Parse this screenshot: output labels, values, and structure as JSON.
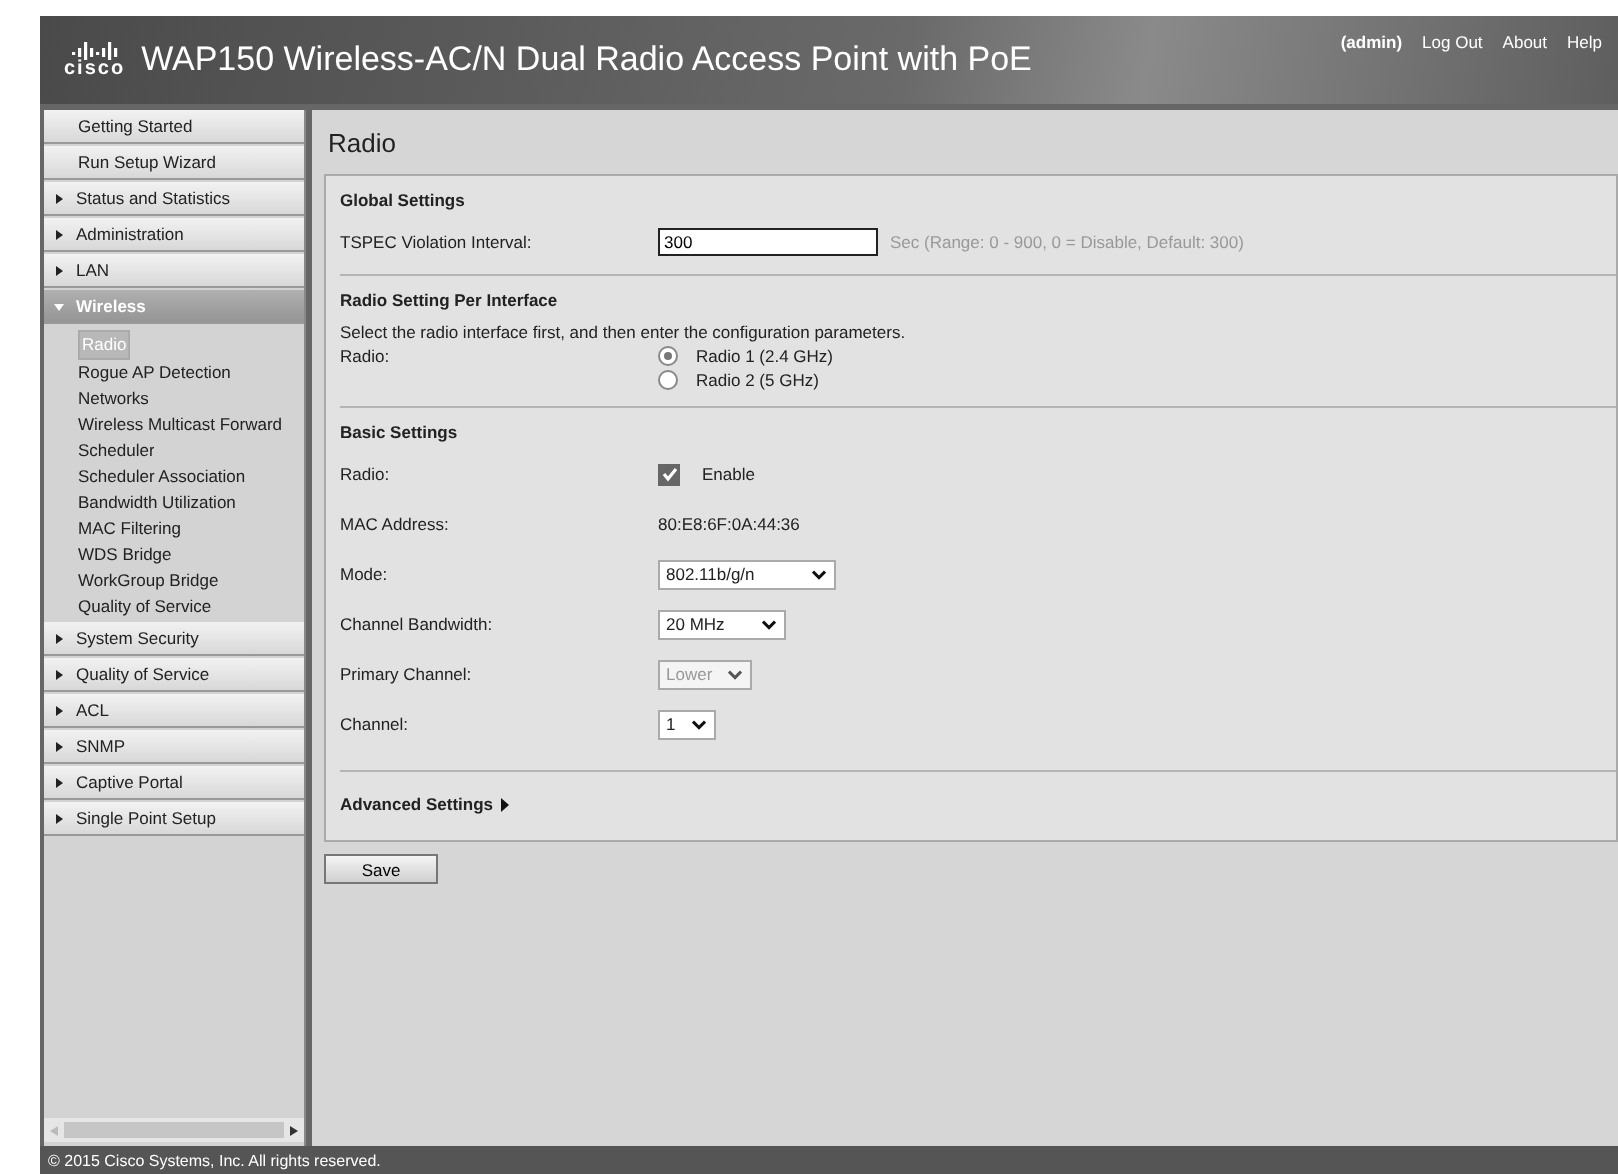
{
  "header": {
    "logo": "cisco",
    "title": "WAP150 Wireless-AC/N Dual Radio Access Point with PoE",
    "user": "(admin)",
    "links": [
      "Log Out",
      "About",
      "Help"
    ]
  },
  "sidebar": {
    "items": [
      {
        "kind": "link",
        "label": "Getting Started"
      },
      {
        "kind": "link",
        "label": "Run Setup Wizard"
      },
      {
        "kind": "group",
        "label": "Status and Statistics",
        "expanded": false
      },
      {
        "kind": "group",
        "label": "Administration",
        "expanded": false
      },
      {
        "kind": "group",
        "label": "LAN",
        "expanded": false
      },
      {
        "kind": "group",
        "label": "Wireless",
        "expanded": true,
        "children": [
          {
            "label": "Radio",
            "selected": true
          },
          {
            "label": "Rogue AP Detection",
            "selected": false
          },
          {
            "label": "Networks",
            "selected": false
          },
          {
            "label": "Wireless Multicast Forward",
            "selected": false
          },
          {
            "label": "Scheduler",
            "selected": false
          },
          {
            "label": "Scheduler Association",
            "selected": false
          },
          {
            "label": "Bandwidth Utilization",
            "selected": false
          },
          {
            "label": "MAC Filtering",
            "selected": false
          },
          {
            "label": "WDS Bridge",
            "selected": false
          },
          {
            "label": "WorkGroup Bridge",
            "selected": false
          },
          {
            "label": "Quality of Service",
            "selected": false
          }
        ]
      },
      {
        "kind": "group",
        "label": "System Security",
        "expanded": false
      },
      {
        "kind": "group",
        "label": "Quality of Service",
        "expanded": false
      },
      {
        "kind": "group",
        "label": "ACL",
        "expanded": false
      },
      {
        "kind": "group",
        "label": "SNMP",
        "expanded": false
      },
      {
        "kind": "group",
        "label": "Captive Portal",
        "expanded": false
      },
      {
        "kind": "group",
        "label": "Single Point Setup",
        "expanded": false
      }
    ]
  },
  "page_title": "Radio",
  "sections": [
    {
      "title": "Global Settings",
      "rows": [
        {
          "kind": "text",
          "label": "TSPEC Violation Interval:",
          "value": "300",
          "hint": "Sec (Range: 0 - 900, 0 = Disable, Default: 300)"
        }
      ]
    },
    {
      "title": "Radio Setting Per Interface",
      "note": "Select the radio interface first, and then enter the configuration parameters.",
      "rows": [
        {
          "kind": "radio",
          "label": "Radio:",
          "options": [
            {
              "label": "Radio 1 (2.4 GHz)",
              "selected": true
            },
            {
              "label": "Radio 2 (5 GHz)",
              "selected": false
            }
          ]
        }
      ]
    },
    {
      "title": "Basic Settings",
      "rows": [
        {
          "kind": "checkbox",
          "label": "Radio:",
          "checked": true,
          "text": "Enable"
        },
        {
          "kind": "static",
          "label": "MAC Address:",
          "value": "80:E8:6F:0A:44:36"
        },
        {
          "kind": "select",
          "label": "Mode:",
          "value": "802.11b/g/n",
          "disabled": false
        },
        {
          "kind": "select",
          "label": "Channel Bandwidth:",
          "value": "20 MHz",
          "disabled": false
        },
        {
          "kind": "select",
          "label": "Primary Channel:",
          "value": "Lower",
          "disabled": true
        },
        {
          "kind": "select",
          "label": "Channel:",
          "value": "1",
          "disabled": false
        }
      ]
    }
  ],
  "advanced": {
    "label": "Advanced Settings",
    "expanded": false
  },
  "save_button": "Save",
  "footer": "© 2015 Cisco Systems, Inc. All rights reserved."
}
